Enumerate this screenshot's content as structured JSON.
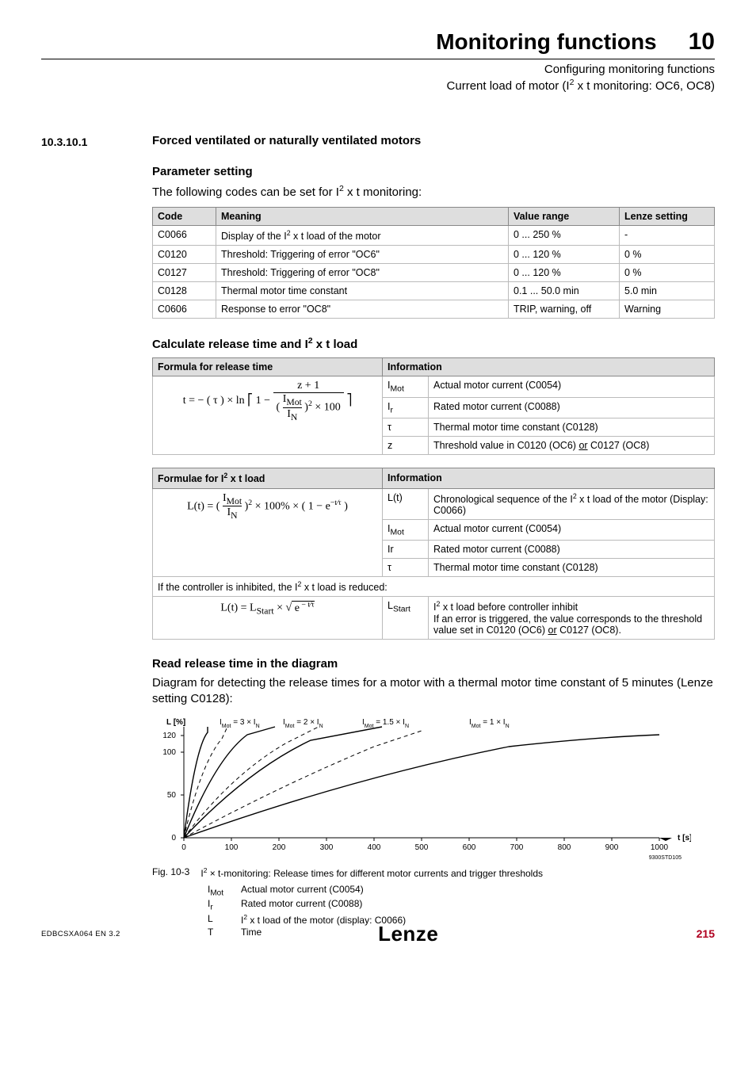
{
  "header": {
    "title": "Monitoring functions",
    "chapter": "10",
    "sub1": "Configuring monitoring functions",
    "sub2_prefix": "Current load of motor (I",
    "sub2_suffix": " x t monitoring: OC6, OC8)"
  },
  "section": {
    "number": "10.3.10.1",
    "title": "Forced ventilated or naturally ventilated motors"
  },
  "paraSetting": {
    "head": "Parameter setting",
    "text_prefix": "The following codes can be set for I",
    "text_suffix": " x t monitoring:"
  },
  "table1": {
    "headers": [
      "Code",
      "Meaning",
      "Value range",
      "Lenze setting"
    ],
    "rows": [
      {
        "code": "C0066",
        "meaning_prefix": "Display of the I",
        "meaning_suffix": " x t load of the motor",
        "range": "0 ... 250 %",
        "lenze": "-"
      },
      {
        "code": "C0120",
        "meaning": "Threshold: Triggering of error \"OC6\"",
        "range": "0 ... 120 %",
        "lenze": "0 %"
      },
      {
        "code": "C0127",
        "meaning": "Threshold: Triggering of error \"OC8\"",
        "range": "0 ... 120 %",
        "lenze": "0 %"
      },
      {
        "code": "C0128",
        "meaning": "Thermal motor time constant",
        "range": "0.1 ... 50.0 min",
        "lenze": "5.0 min"
      },
      {
        "code": "C0606",
        "meaning": "Response to error \"OC8\"",
        "range": "TRIP, warning, off",
        "lenze": "Warning"
      }
    ]
  },
  "calcHead_prefix": "Calculate release time and I",
  "calcHead_suffix": " x t load",
  "table2": {
    "headLeft": "Formula for release time",
    "headRight": "Information",
    "rows": [
      {
        "sym": "I",
        "sub": "Mot",
        "desc": "Actual motor current (C0054)"
      },
      {
        "sym": "I",
        "sub": "r",
        "desc": "Rated motor current (C0088)"
      },
      {
        "sym": "τ",
        "sub": "",
        "desc": "Thermal motor time constant (C0128)"
      },
      {
        "sym": "z",
        "sub": "",
        "desc": "Threshold value in C0120 (OC6) or C0127 (OC8)"
      }
    ]
  },
  "table3": {
    "headLeft_prefix": "Formulae for I",
    "headLeft_suffix": " x t load",
    "headRight": "Information",
    "rows": [
      {
        "sym": "L(t)",
        "desc_prefix": "Chronological sequence of the I",
        "desc_suffix": " x t load of the motor (Display: C0066)"
      },
      {
        "sym": "I",
        "sub": "Mot",
        "desc": "Actual motor current (C0054)"
      },
      {
        "sym": "Ir",
        "desc": "Rated motor current (C0088)"
      },
      {
        "sym": "τ",
        "desc": "Thermal motor time constant (C0128)"
      }
    ],
    "midNote_prefix": "If the controller is inhibited, the I",
    "midNote_suffix": " x t load is reduced:",
    "rows2": [
      {
        "sym": "L",
        "sub": "Start",
        "desc_prefix": "I",
        "desc_mid": " x t load before controller inhibit",
        "desc_line2": "If an error is triggered, the value corresponds to the threshold value set in C0120 (OC6) or C0127 (OC8)."
      }
    ]
  },
  "readHead": "Read release time in the diagram",
  "readText": "Diagram for detecting the release times for a motor with a thermal motor time constant of 5 minutes (Lenze setting C0128):",
  "figCaption": {
    "num": "Fig. 10-3",
    "text_prefix": "I",
    "text_mid": " × t-monitoring: Release times for different motor currents and trigger thresholds"
  },
  "legend": [
    {
      "sym": "I",
      "sub": "Mot",
      "desc": "Actual motor current (C0054)"
    },
    {
      "sym": "I",
      "sub": "r",
      "desc": "Rated motor current (C0088)"
    },
    {
      "sym": "L",
      "desc_prefix": "I",
      "desc_suffix": " x t load of the motor (display: C0066)"
    },
    {
      "sym": "T",
      "desc": "Time"
    }
  ],
  "footer": {
    "docid": "EDBCSXA064 EN 3.2",
    "logo": "Lenze",
    "page": "215"
  },
  "chart_data": {
    "type": "line",
    "xlabel": "t [s]",
    "ylabel": "L [%]",
    "ylim": [
      0,
      130
    ],
    "xlim": [
      0,
      1000
    ],
    "x": [
      0,
      100,
      200,
      300,
      400,
      500,
      600,
      700,
      800,
      900,
      1000
    ],
    "yticks": [
      0,
      50,
      100,
      120
    ],
    "series_labels": [
      "IMot = 3 × IN",
      "IMot = 2 × IN",
      "IMot = 1.5 × IN",
      "IMot = 1 × IN"
    ],
    "note": "Curves rise from 0 toward asymptotes; solid and dashed lines per series.",
    "code_tag": "9300STD105"
  }
}
